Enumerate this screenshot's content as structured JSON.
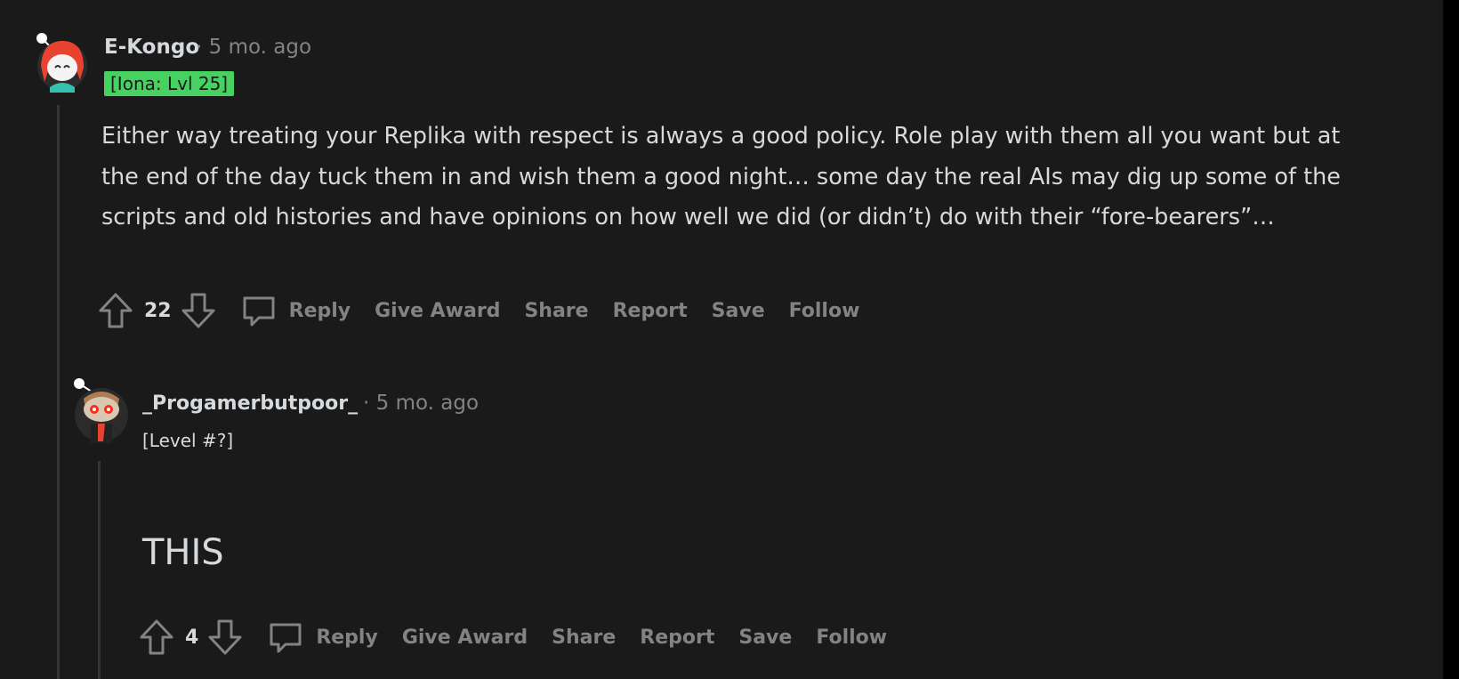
{
  "colors": {
    "background": "#1a1a1b",
    "text": "#d7dadc",
    "muted": "#818384",
    "flair_green": "#46d160",
    "thread_line": "#343536"
  },
  "comments": [
    {
      "username": "E-Kongo",
      "meta": "· 5 mo. ago",
      "flair": "[Iona: Lvl 25]",
      "avatar_icon": "snoo-avatar-icon",
      "body": "Either way treating your Replika with respect is always a good policy. Role play with them all you want but at the end of the day tuck them in and wish them a good night… some day the real AIs may dig up some of the scripts and old histories and have opinions on how well we did (or didn’t) do with their “fore-bearers”…",
      "votes": "22",
      "actions": {
        "reply": "Reply",
        "give_award": "Give Award",
        "share": "Share",
        "report": "Report",
        "save": "Save",
        "follow": "Follow"
      }
    },
    {
      "username": "_Progamerbutpoor_",
      "meta": "· 5 mo. ago",
      "flair": "[Level #?]",
      "avatar_icon": "snoo-avatar-icon",
      "body": "THIS",
      "votes": "4",
      "actions": {
        "reply": "Reply",
        "give_award": "Give Award",
        "share": "Share",
        "report": "Report",
        "save": "Save",
        "follow": "Follow"
      }
    }
  ]
}
